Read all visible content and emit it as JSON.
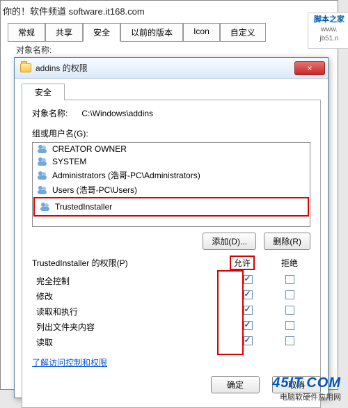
{
  "watermark": "你的！软件频道 software.it168.com",
  "bg": {
    "tabs": [
      "常规",
      "共享",
      "安全",
      "以前的版本",
      "Icon",
      "自定义"
    ],
    "objname_label": "对象名称:"
  },
  "sidecard": {
    "line1": "脚本之家",
    "line2": "www.",
    "line3": "jb51.n"
  },
  "dialog": {
    "title": "addins 的权限",
    "close": "×",
    "tab": "安全",
    "objname_label": "对象名称:",
    "objname_value": "C:\\Windows\\addins",
    "group_label": "组或用户名(G):",
    "users": [
      "CREATOR OWNER",
      "SYSTEM",
      "Administrators (浩哥-PC\\Administrators)",
      "Users (浩哥-PC\\Users)",
      "TrustedInstaller"
    ],
    "add_btn": "添加(D)...",
    "remove_btn": "删除(R)",
    "perm_header": "TrustedInstaller 的权限(P)",
    "allow": "允许",
    "deny": "拒绝",
    "perms": [
      {
        "name": "完全控制",
        "allow": true,
        "deny": false
      },
      {
        "name": "修改",
        "allow": true,
        "deny": false
      },
      {
        "name": "读取和执行",
        "allow": true,
        "deny": false
      },
      {
        "name": "列出文件夹内容",
        "allow": true,
        "deny": false
      },
      {
        "name": "读取",
        "allow": true,
        "deny": false
      }
    ],
    "link": "了解访问控制和权限",
    "ok": "确定",
    "cancel": "取消"
  },
  "brand": {
    "big": "45IT.COM",
    "sub": "电脑软硬件应用网"
  }
}
